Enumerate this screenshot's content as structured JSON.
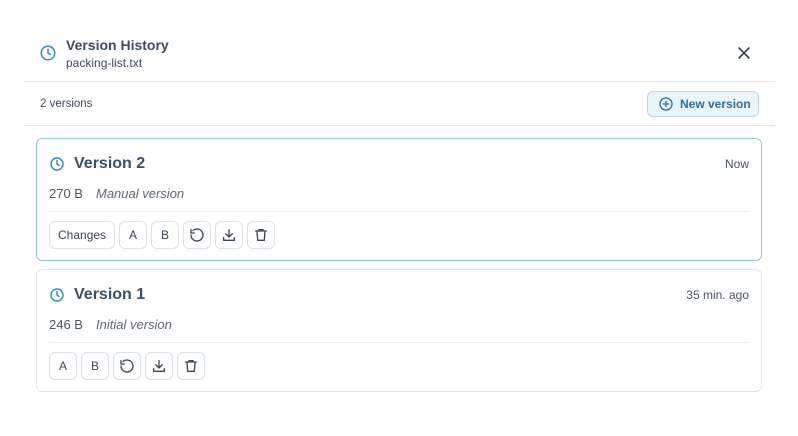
{
  "header": {
    "title": "Version History",
    "filename": "packing-list.txt",
    "clock_icon": "clock-icon",
    "close_icon": "close-icon"
  },
  "toolbar": {
    "count": "2 versions",
    "new_version_label": "New version",
    "new_icon": "plus-circle-icon"
  },
  "versions": [
    {
      "name": "Version 2",
      "time": "Now",
      "size": "270 B",
      "note": "Manual version",
      "active": true,
      "actions": {
        "changes_label": "Changes",
        "a_label": "A",
        "b_label": "B"
      }
    },
    {
      "name": "Version 1",
      "time": "35 min. ago",
      "size": "246 B",
      "note": "Initial version",
      "active": false,
      "actions": {
        "a_label": "A",
        "b_label": "B"
      }
    }
  ],
  "colors": {
    "accent": "#2f8fc0",
    "active_border": "#8ec9e0",
    "new_button_bg": "#eaf4fb"
  }
}
